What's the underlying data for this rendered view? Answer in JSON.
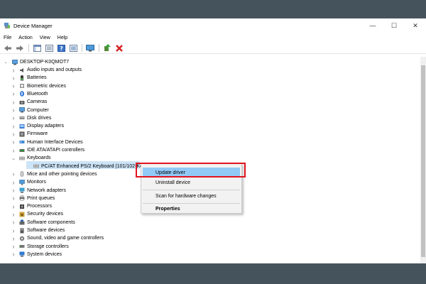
{
  "window": {
    "title": "Device Manager",
    "controls": {
      "minimize": "—",
      "maximize": "☐",
      "close": "✕"
    }
  },
  "menu": [
    "File",
    "Action",
    "View",
    "Help"
  ],
  "toolbar": [
    "back-arrow-icon",
    "forward-arrow-icon",
    "show-hide-console-tree-icon",
    "properties-icon",
    "help-icon",
    "view-icon",
    "monitor-icon",
    "update-driver-icon",
    "uninstall-icon"
  ],
  "tree": {
    "root": "DESKTOP-K0QMOT7",
    "categories": [
      {
        "label": "Audio inputs and outputs",
        "icon": "speaker-icon",
        "expanded": false
      },
      {
        "label": "Batteries",
        "icon": "battery-icon",
        "expanded": false
      },
      {
        "label": "Biometric devices",
        "icon": "biometric-icon",
        "expanded": false
      },
      {
        "label": "Bluetooth",
        "icon": "bluetooth-icon",
        "expanded": false
      },
      {
        "label": "Cameras",
        "icon": "camera-icon",
        "expanded": false
      },
      {
        "label": "Computer",
        "icon": "computer-icon",
        "expanded": false
      },
      {
        "label": "Disk drives",
        "icon": "disk-drive-icon",
        "expanded": false
      },
      {
        "label": "Display adapters",
        "icon": "display-adapter-icon",
        "expanded": false
      },
      {
        "label": "Firmware",
        "icon": "firmware-icon",
        "expanded": false
      },
      {
        "label": "Human Interface Devices",
        "icon": "hid-icon",
        "expanded": false
      },
      {
        "label": "IDE ATA/ATAPI controllers",
        "icon": "ide-controller-icon",
        "expanded": false
      },
      {
        "label": "Keyboards",
        "icon": "keyboard-icon",
        "expanded": true
      },
      {
        "label": "PC/AT Enhanced PS/2 Keyboard (101/102-Key)",
        "icon": "keyboard-icon",
        "child": true,
        "selected": true
      },
      {
        "label": "Mice and other pointing devices",
        "icon": "mouse-icon",
        "expanded": false
      },
      {
        "label": "Monitors",
        "icon": "monitor-icon",
        "expanded": false
      },
      {
        "label": "Network adapters",
        "icon": "network-adapter-icon",
        "expanded": false
      },
      {
        "label": "Print queues",
        "icon": "printer-icon",
        "expanded": false
      },
      {
        "label": "Processors",
        "icon": "processor-icon",
        "expanded": false
      },
      {
        "label": "Security devices",
        "icon": "security-device-icon",
        "expanded": false
      },
      {
        "label": "Software components",
        "icon": "software-component-icon",
        "expanded": false
      },
      {
        "label": "Software devices",
        "icon": "software-device-icon",
        "expanded": false
      },
      {
        "label": "Sound, video and game controllers",
        "icon": "sound-icon",
        "expanded": false
      },
      {
        "label": "Storage controllers",
        "icon": "storage-controller-icon",
        "expanded": false
      },
      {
        "label": "System devices",
        "icon": "system-device-icon",
        "expanded": false
      }
    ]
  },
  "context_menu": {
    "items": [
      {
        "label": "Update driver",
        "hover": true,
        "bold": false
      },
      {
        "label": "Uninstall device",
        "hover": false,
        "bold": false
      },
      {
        "label": "Scan for hardware changes",
        "hover": false,
        "bold": false
      },
      {
        "label": "Properties",
        "hover": false,
        "bold": true
      }
    ]
  },
  "colors": {
    "background": "#45535c",
    "selection": "#cce4f7",
    "menu_hover": "#91c9f7",
    "highlight_border": "#e0141e"
  }
}
